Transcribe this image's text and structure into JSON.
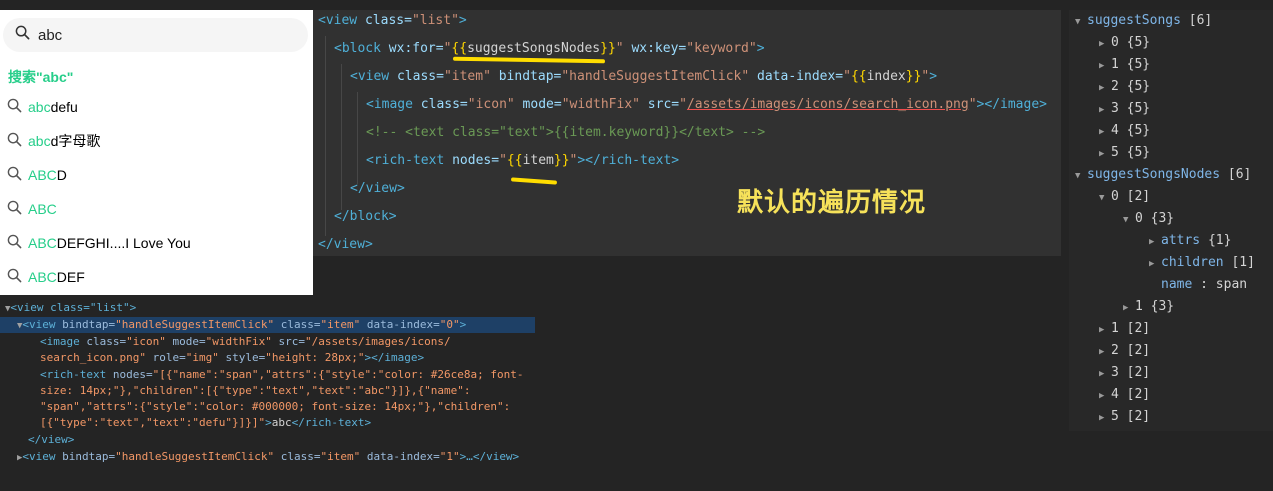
{
  "phone": {
    "search_value": "abc",
    "hint": "搜索\"abc\"",
    "items": [
      {
        "hl": "abc",
        "rest": "defu"
      },
      {
        "hl": "abc",
        "rest": "d字母歌"
      },
      {
        "hl": "ABC",
        "rest": "D"
      },
      {
        "hl": "ABC",
        "rest": ""
      },
      {
        "hl": "ABC",
        "rest": "DEFGHI....I Love You"
      },
      {
        "hl": "ABC",
        "rest": "DEF"
      }
    ]
  },
  "code": {
    "l1_tag": "<view",
    "l1_attr": " class=",
    "l1_val": "\"list\"",
    "l1_end": ">",
    "l2_tag": "<block",
    "l2_attr": " wx:for=",
    "l2_q1": "\"",
    "l2_b1": "{{",
    "l2_var": "suggestSongsNodes",
    "l2_b2": "}}",
    "l2_q2": "\"",
    "l2_attr2": " wx:key=",
    "l2_val2": "\"keyword\"",
    "l2_end": ">",
    "l3_tag": "<view",
    "l3_attr": " class=",
    "l3_val": "\"item\"",
    "l3_attr2": " bindtap=",
    "l3_val2": "\"handleSuggestItemClick\"",
    "l3_attr3": " data-index=",
    "l3_q1": "\"",
    "l3_b1": "{{",
    "l3_var": "index",
    "l3_b2": "}}",
    "l3_q2": "\"",
    "l3_end": ">",
    "l4_tag": "<image",
    "l4_attr": " class=",
    "l4_val": "\"icon\"",
    "l4_attr2": " mode=",
    "l4_val2": "\"widthFix\"",
    "l4_attr3": " src=",
    "l4_q1": "\"",
    "l4_url": "/assets/images/icons/search_icon.png",
    "l4_q2": "\"",
    "l4_end": "></image>",
    "l5_comment": "<!-- <text class=\"text\">{{item.keyword}}</text> -->",
    "l6_tag": "<rich-text",
    "l6_attr": " nodes=",
    "l6_q1": "\"",
    "l6_b1": "{{",
    "l6_var": "item",
    "l6_b2": "}}",
    "l6_q2": "\"",
    "l6_end": "></rich-text>",
    "l7": "</view>",
    "l8": "</block>",
    "l9": "</view>",
    "annotation": "默认的遍历情况"
  },
  "dom": {
    "l1": "<view class=\"list\">",
    "l2_tag": "<view",
    "l2_a1": " bindtap=",
    "l2_v1": "\"handleSuggestItemClick\"",
    "l2_a2": " class=",
    "l2_v2": "\"item\"",
    "l2_a3": " data-index=",
    "l2_v3": "\"0\"",
    "l2_end": ">",
    "l3_tag": "<image",
    "l3_a1": " class=",
    "l3_v1": "\"icon\"",
    "l3_a2": " mode=",
    "l3_v2": "\"widthFix\"",
    "l3_a3": " src=",
    "l3_v3a": "\"/assets/images/icons/",
    "l4_v3b": "search_icon.png\"",
    "l4_a4": " role=",
    "l4_v4": "\"img\"",
    "l4_a5": " style=",
    "l4_v5": "\"height: 28px;\"",
    "l4_end": "></image>",
    "l5_tag": "<rich-text",
    "l5_a1": " nodes=",
    "l5_v": "\"[{\"name\":\"span\",\"attrs\":{\"style\":\"color: #26ce8a; font-",
    "l6_v": "size: 14px;\"},\"children\":[{\"type\":\"text\",\"text\":\"abc\"}]},{\"name\":",
    "l7_v": "\"span\",\"attrs\":{\"style\":\"color: #000000; font-size: 14px;\"},\"children\":",
    "l8_v": "[{\"type\":\"text\",\"text\":\"defu\"}]}]\"",
    "l8_end": ">",
    "l8_txt": "abc",
    "l8_close": "</rich-text>",
    "l9": "</view>",
    "l10_tag": "<view",
    "l10_a1": " bindtap=",
    "l10_v1": "\"handleSuggestItemClick\"",
    "l10_a2": " class=",
    "l10_v2": "\"item\"",
    "l10_a3": " data-index=",
    "l10_v3": "\"1\"",
    "l10_end": ">…</view>"
  },
  "appdata": {
    "songs_key": "suggestSongs",
    "songs_len": "[6]",
    "songs": [
      {
        "k": "0",
        "v": "{5}"
      },
      {
        "k": "1",
        "v": "{5}"
      },
      {
        "k": "2",
        "v": "{5}"
      },
      {
        "k": "3",
        "v": "{5}"
      },
      {
        "k": "4",
        "v": "{5}"
      },
      {
        "k": "5",
        "v": "{5}"
      }
    ],
    "nodes_key": "suggestSongsNodes",
    "nodes_len": "[6]",
    "n0_k": "0",
    "n0_v": "[2]",
    "n00_k": "0",
    "n00_v": "{3}",
    "attrs_k": "attrs",
    "attrs_v": "{1}",
    "children_k": "children",
    "children_v": "[1]",
    "name_k": "name",
    "name_sep": ":",
    "name_v": "span",
    "n01_k": "1",
    "n01_v": "{3}",
    "nodes_rest": [
      {
        "k": "1",
        "v": "[2]"
      },
      {
        "k": "2",
        "v": "[2]"
      },
      {
        "k": "3",
        "v": "[2]"
      },
      {
        "k": "4",
        "v": "[2]"
      },
      {
        "k": "5",
        "v": "[2]"
      }
    ]
  }
}
